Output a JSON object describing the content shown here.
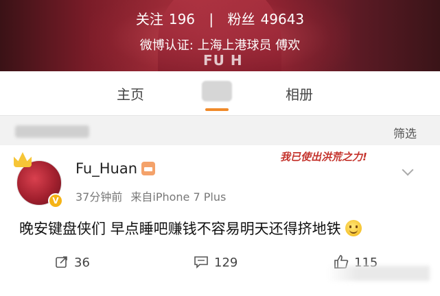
{
  "header": {
    "following_label": "关注",
    "following_count": "196",
    "separator": "|",
    "followers_label": "粉丝",
    "followers_count": "49643",
    "verification": "微博认证: 上海上港球员 傅欢",
    "banner_jersey_text": "FU H"
  },
  "tabs": {
    "home": "主页",
    "album": "相册",
    "active_indicator_color": "#f08a2a"
  },
  "filter": {
    "label": "筛选"
  },
  "post": {
    "username": "Fu_Huan",
    "time": "37分钟前",
    "source": "来自iPhone 7 Plus",
    "badge_text": "我已使出洪荒之力!",
    "content": "晚安键盘侠们 早点睡吧赚钱不容易明天还得挤地铁",
    "repost_count": "36",
    "comment_count": "129",
    "like_count": "115"
  },
  "icons": {
    "crown": "crown-icon",
    "verified": "verified-v-icon",
    "member": "member-icon",
    "expand": "chevron-down-icon",
    "repost": "repost-icon",
    "comment": "comment-icon",
    "like": "thumbs-up-icon",
    "emoji": "smile-emoji-icon"
  }
}
